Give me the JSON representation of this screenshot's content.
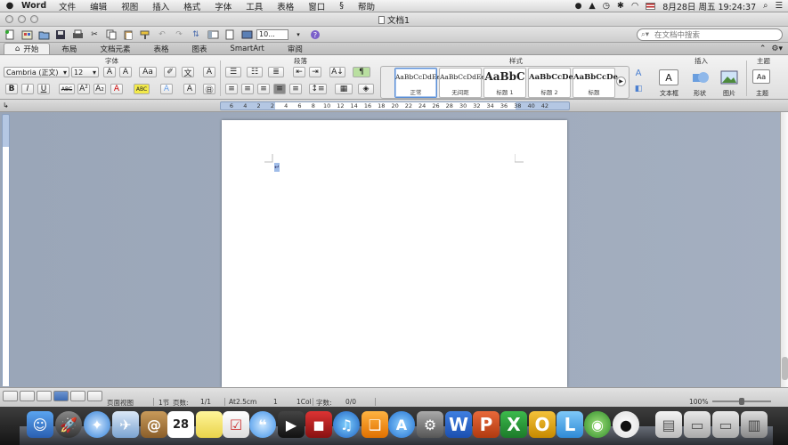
{
  "menubar": {
    "app_name": "Word",
    "items": [
      "文件",
      "编辑",
      "视图",
      "插入",
      "格式",
      "字体",
      "工具",
      "表格",
      "窗口",
      "帮助"
    ],
    "clock": "8月28日 周五  19:24:37"
  },
  "window": {
    "title": "文档1"
  },
  "toolbar": {
    "zoom": "10...",
    "search_placeholder": "在文档中搜索"
  },
  "ribbon": {
    "tabs": [
      "开始",
      "布局",
      "文档元素",
      "表格",
      "图表",
      "SmartArt",
      "审阅"
    ],
    "groups": {
      "font": "字体",
      "paragraph": "段落",
      "styles": "样式",
      "insert": "插入",
      "theme": "主题"
    },
    "font_name": "Cambria (正文)",
    "font_size": "12",
    "styles": [
      {
        "sample": "AaBbCcDdEe",
        "name": "正常"
      },
      {
        "sample": "AaBbCcDdEe",
        "name": "无间距"
      },
      {
        "sample": "AaBbC",
        "name": "标题 1"
      },
      {
        "sample": "AaBbCcDe",
        "name": "标题 2"
      },
      {
        "sample": "AaBbCcDe",
        "name": "标题"
      }
    ],
    "insert_buttons": [
      "文本框",
      "形状",
      "图片"
    ],
    "theme_button": "主题"
  },
  "ruler": {
    "ticks": [
      "6",
      "4",
      "2",
      "2",
      "4",
      "6",
      "8",
      "10",
      "12",
      "14",
      "16",
      "18",
      "20",
      "22",
      "24",
      "26",
      "28",
      "30",
      "32",
      "34",
      "36",
      "38",
      "40",
      "42"
    ]
  },
  "statusbar": {
    "view": "页面视图",
    "section_label": "1节",
    "pages_label": "页数:",
    "pages_value": "1/1",
    "at": "At2.5cm",
    "line": "1",
    "col": "1Col",
    "words_label": "字数:",
    "words_value": "0/0",
    "zoom": "100%"
  },
  "dock": {
    "calendar_day": "28"
  },
  "colors": {
    "accent": "#5a8ed6",
    "workspace": "#9aa6b8",
    "ruler": "#b4c7e3"
  }
}
